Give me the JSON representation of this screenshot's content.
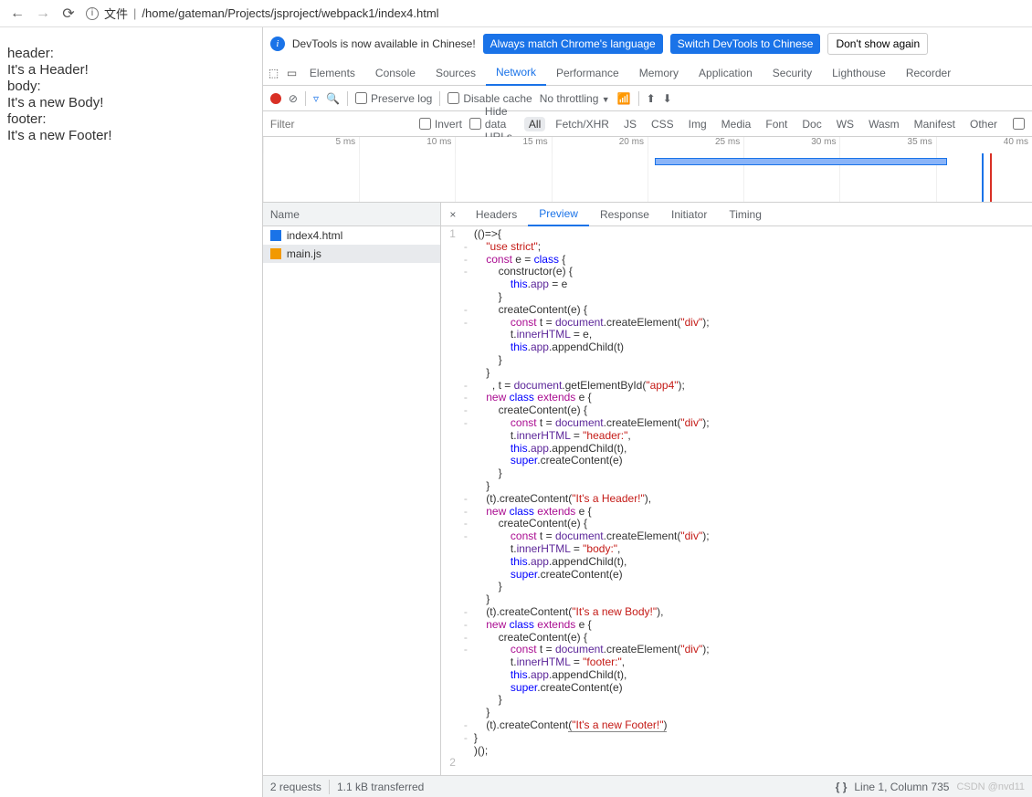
{
  "browser": {
    "url_label": "文件",
    "url_path": "/home/gateman/Projects/jsproject/webpack1/index4.html"
  },
  "page_content": {
    "l1": "header:",
    "l2": "It's a Header!",
    "l3": "body:",
    "l4": "It's a new Body!",
    "l5": "footer:",
    "l6": "It's a new Footer!"
  },
  "infobar": {
    "msg": "DevTools is now available in Chinese!",
    "btn1": "Always match Chrome's language",
    "btn2": "Switch DevTools to Chinese",
    "btn3": "Don't show again"
  },
  "tabs": [
    "Elements",
    "Console",
    "Sources",
    "Network",
    "Performance",
    "Memory",
    "Application",
    "Security",
    "Lighthouse",
    "Recorder"
  ],
  "active_tab": "Network",
  "net_toolbar": {
    "preserve": "Preserve log",
    "disable": "Disable cache",
    "throttle": "No throttling"
  },
  "filter": {
    "placeholder": "Filter",
    "invert": "Invert",
    "hide": "Hide data URLs",
    "pills": [
      "All",
      "Fetch/XHR",
      "JS",
      "CSS",
      "Img",
      "Media",
      "Font",
      "Doc",
      "WS",
      "Wasm",
      "Manifest",
      "Other"
    ]
  },
  "timeline_ticks": [
    "5 ms",
    "10 ms",
    "15 ms",
    "20 ms",
    "25 ms",
    "30 ms",
    "35 ms",
    "40 ms"
  ],
  "requests": {
    "header": "Name",
    "rows": [
      {
        "name": "index4.html",
        "type": "html"
      },
      {
        "name": "main.js",
        "type": "js",
        "selected": true
      }
    ]
  },
  "detail_tabs": [
    "Headers",
    "Preview",
    "Response",
    "Initiator",
    "Timing"
  ],
  "active_detail_tab": "Preview",
  "status": {
    "requests": "2 requests",
    "transferred": "1.1 kB transferred",
    "cursor": "Line 1, Column 735",
    "watermark": "CSDN @nvd11"
  },
  "code_lines": [
    {
      "n": "1",
      "g": "",
      "t": "(()=>{"
    },
    {
      "n": "",
      "g": "-",
      "t": "    <s>\"use strict\"</s>;"
    },
    {
      "n": "",
      "g": "-",
      "t": "    <k>const</k> e = <d>class</d> {"
    },
    {
      "n": "",
      "g": "-",
      "t": "        constructor(e) {"
    },
    {
      "n": "",
      "g": "",
      "t": "            <d>this</d>.<p>app</p> = e"
    },
    {
      "n": "",
      "g": "",
      "t": "        }"
    },
    {
      "n": "",
      "g": "-",
      "t": "        createContent(e) {"
    },
    {
      "n": "",
      "g": "-",
      "t": "            <k>const</k> t = <p>document</p>.createElement(<s>\"div\"</s>);"
    },
    {
      "n": "",
      "g": "",
      "t": "            t.<p>innerHTML</p> = e,"
    },
    {
      "n": "",
      "g": "",
      "t": "            <d>this</d>.<p>app</p>.appendChild(t)"
    },
    {
      "n": "",
      "g": "",
      "t": "        }"
    },
    {
      "n": "",
      "g": "",
      "t": "    }"
    },
    {
      "n": "",
      "g": "-",
      "t": "      , t = <p>document</p>.getElementById(<s>\"app4\"</s>);"
    },
    {
      "n": "",
      "g": "-",
      "t": "    <k>new</k> <d>class</d> <k>extends</k> e {"
    },
    {
      "n": "",
      "g": "-",
      "t": "        createContent(e) {"
    },
    {
      "n": "",
      "g": "-",
      "t": "            <k>const</k> t = <p>document</p>.createElement(<s>\"div\"</s>);"
    },
    {
      "n": "",
      "g": "",
      "t": "            t.<p>innerHTML</p> = <s>\"header:\"</s>,"
    },
    {
      "n": "",
      "g": "",
      "t": "            <d>this</d>.<p>app</p>.appendChild(t),"
    },
    {
      "n": "",
      "g": "",
      "t": "            <d>super</d>.createContent(e)"
    },
    {
      "n": "",
      "g": "",
      "t": "        }"
    },
    {
      "n": "",
      "g": "",
      "t": "    }"
    },
    {
      "n": "",
      "g": "-",
      "t": "    (t).createContent(<s>\"It's a Header!\"</s>),"
    },
    {
      "n": "",
      "g": "-",
      "t": "    <k>new</k> <d>class</d> <k>extends</k> e {"
    },
    {
      "n": "",
      "g": "-",
      "t": "        createContent(e) {"
    },
    {
      "n": "",
      "g": "-",
      "t": "            <k>const</k> t = <p>document</p>.createElement(<s>\"div\"</s>);"
    },
    {
      "n": "",
      "g": "",
      "t": "            t.<p>innerHTML</p> = <s>\"body:\"</s>,"
    },
    {
      "n": "",
      "g": "",
      "t": "            <d>this</d>.<p>app</p>.appendChild(t),"
    },
    {
      "n": "",
      "g": "",
      "t": "            <d>super</d>.createContent(e)"
    },
    {
      "n": "",
      "g": "",
      "t": "        }"
    },
    {
      "n": "",
      "g": "",
      "t": "    }"
    },
    {
      "n": "",
      "g": "-",
      "t": "    (t).createContent(<s>\"It's a new Body!\"</s>),"
    },
    {
      "n": "",
      "g": "-",
      "t": "    <k>new</k> <d>class</d> <k>extends</k> e {"
    },
    {
      "n": "",
      "g": "-",
      "t": "        createContent(e) {"
    },
    {
      "n": "",
      "g": "-",
      "t": "            <k>const</k> t = <p>document</p>.createElement(<s>\"div\"</s>);"
    },
    {
      "n": "",
      "g": "",
      "t": "            t.<p>innerHTML</p> = <s>\"footer:\"</s>,"
    },
    {
      "n": "",
      "g": "",
      "t": "            <d>this</d>.<p>app</p>.appendChild(t),"
    },
    {
      "n": "",
      "g": "",
      "t": "            <d>super</d>.createContent(e)"
    },
    {
      "n": "",
      "g": "",
      "t": "        }"
    },
    {
      "n": "",
      "g": "",
      "t": "    }"
    },
    {
      "n": "",
      "g": "-",
      "t": "    (t).createContent<u>(<s>\"It's a new Footer!\"</s>)</u>"
    },
    {
      "n": "",
      "g": "-",
      "t": "}"
    },
    {
      "n": "",
      "g": "",
      "t": ")();"
    },
    {
      "n": "2",
      "g": "",
      "t": ""
    }
  ]
}
